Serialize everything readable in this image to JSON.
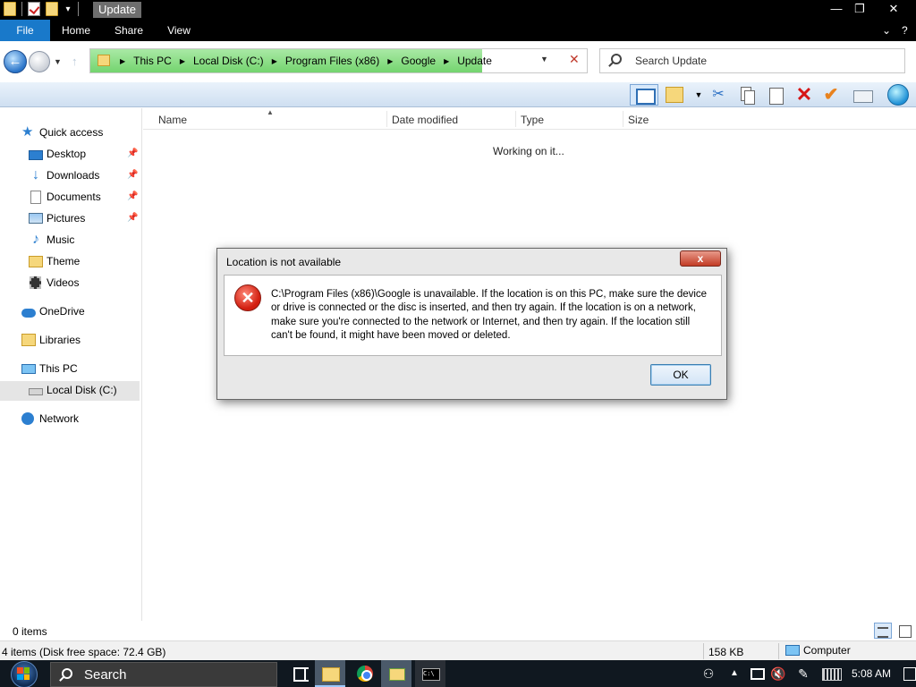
{
  "window": {
    "title": "Update",
    "controls": {
      "minimize": "—",
      "maximize": "❐",
      "close": "✕"
    }
  },
  "ribbon": {
    "tabs": [
      "File",
      "Home",
      "Share",
      "View"
    ],
    "collapse": "⌄",
    "help": "?"
  },
  "address": {
    "crumbs": [
      "This PC",
      "Local Disk (C:)",
      "Program Files (x86)",
      "Google",
      "Update"
    ],
    "highlight_color": "#74d46f"
  },
  "search": {
    "placeholder": "Search Update"
  },
  "navigation": {
    "items": [
      {
        "label": "Quick access",
        "icon": "star-icon",
        "pinned": false
      },
      {
        "label": "Desktop",
        "icon": "desktop-icon",
        "pinned": true
      },
      {
        "label": "Downloads",
        "icon": "download-icon",
        "pinned": true
      },
      {
        "label": "Documents",
        "icon": "documents-icon",
        "pinned": true
      },
      {
        "label": "Pictures",
        "icon": "pictures-icon",
        "pinned": true
      },
      {
        "label": "Music",
        "icon": "music-icon",
        "pinned": false
      },
      {
        "label": "Theme",
        "icon": "folder-icon",
        "pinned": false
      },
      {
        "label": "Videos",
        "icon": "videos-icon",
        "pinned": false
      },
      {
        "label": "OneDrive",
        "icon": "onedrive-icon",
        "pinned": false
      },
      {
        "label": "Libraries",
        "icon": "libraries-icon",
        "pinned": false
      },
      {
        "label": "This PC",
        "icon": "this-pc-icon",
        "pinned": false
      },
      {
        "label": "Local Disk (C:)",
        "icon": "disk-icon",
        "pinned": false,
        "selected": true
      },
      {
        "label": "Network",
        "icon": "network-icon",
        "pinned": false
      }
    ]
  },
  "file_list": {
    "columns": [
      "Name",
      "Date modified",
      "Type",
      "Size"
    ],
    "status_message": "Working on it..."
  },
  "dialog": {
    "title": "Location is not available",
    "close": "x",
    "message": "C:\\Program Files (x86)\\Google is unavailable. If the location is on this PC, make sure the device or drive is connected or the disc is inserted, and then try again. If the location is on a network, make sure you're connected to the network or Internet, and then try again. If the location still can't be found, it might have been moved or deleted.",
    "ok_label": "OK",
    "icon": "error-icon"
  },
  "statusbar": {
    "items": "0 items",
    "summary": "4 items (Disk free space: 72.4 GB)",
    "size": "158 KB",
    "location": "Computer"
  },
  "taskbar": {
    "search_label": "Search",
    "clock": "5:08 AM"
  }
}
